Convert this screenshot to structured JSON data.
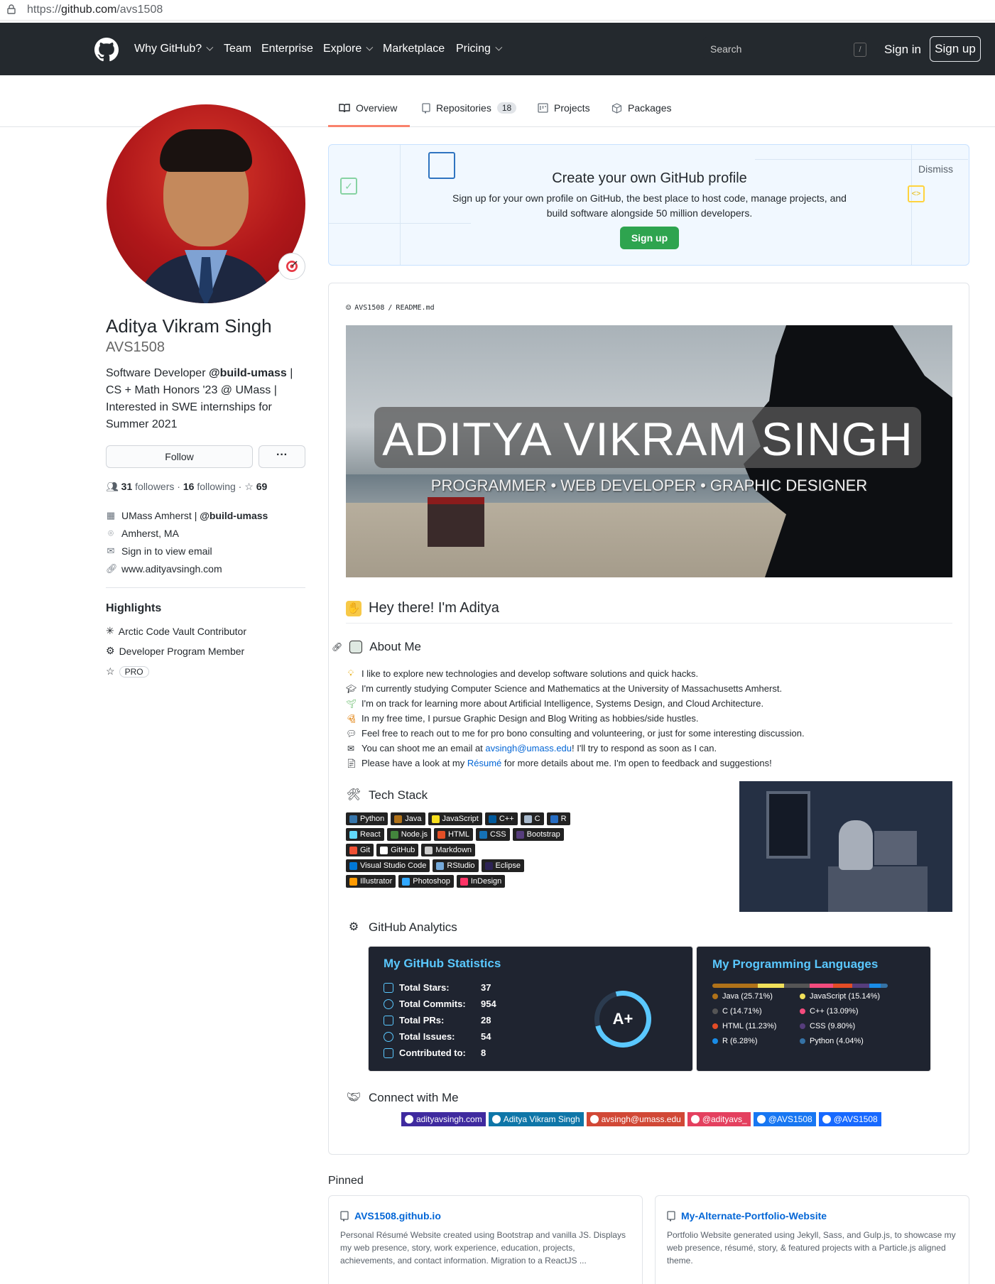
{
  "browser": {
    "url_prefix": "https://",
    "url_host": "github.com",
    "url_path": "/avs1508"
  },
  "header": {
    "nav": [
      {
        "label": "Why GitHub?",
        "caret": true
      },
      {
        "label": "Team",
        "caret": false
      },
      {
        "label": "Enterprise",
        "caret": false
      },
      {
        "label": "Explore",
        "caret": true
      },
      {
        "label": "Marketplace",
        "caret": false
      },
      {
        "label": "Pricing",
        "caret": true
      }
    ],
    "search_placeholder": "Search",
    "search_shortcut": "/",
    "sign_in": "Sign in",
    "sign_up": "Sign up"
  },
  "tabs": [
    {
      "label": "Overview",
      "icon": "book-icon",
      "active": true
    },
    {
      "label": "Repositories",
      "icon": "repo-icon",
      "count": "18"
    },
    {
      "label": "Projects",
      "icon": "project-icon"
    },
    {
      "label": "Packages",
      "icon": "package-icon"
    }
  ],
  "profile": {
    "full_name": "Aditya Vikram Singh",
    "username": "AVS1508",
    "bio_pre": "Software Developer ",
    "bio_org": "@build-umass",
    "bio_post": " | CS + Math Honors '23 @ UMass | Interested in SWE internships for Summer 2021",
    "follow_label": "Follow",
    "more_label": "···",
    "followers": "31",
    "followers_label": "followers",
    "following": "16",
    "following_label": "following",
    "stars": "69",
    "org": "UMass Amherst | ",
    "org_handle": "@build-umass",
    "location": "Amherst, MA",
    "email": "Sign in to view email",
    "website": "www.adityavsingh.com"
  },
  "highlights": {
    "title": "Highlights",
    "items": [
      "Arctic Code Vault Contributor",
      "Developer Program Member"
    ],
    "pro": "PRO"
  },
  "banner": {
    "title": "Create your own GitHub profile",
    "subtitle": "Sign up for your own profile on GitHub, the best place to host code, manage projects, and build software alongside 50 million developers.",
    "button": "Sign up",
    "dismiss": "Dismiss"
  },
  "readme": {
    "path_user": "AVS1508",
    "path_sep": "/",
    "path_file": "README.md",
    "hero_name": "ADITYA VIKRAM SINGH",
    "hero_sub": "PROGRAMMER • WEB DEVELOPER • GRAPHIC DESIGNER",
    "greeting": "Hey there! I'm Aditya",
    "about_title": "About Me",
    "about_lines": [
      {
        "pre": "I like to explore new technologies and develop software solutions and quick hacks.",
        "link": "",
        "post": ""
      },
      {
        "pre": "I'm currently studying Computer Science and Mathematics at the University of Massachusetts Amherst.",
        "link": "",
        "post": ""
      },
      {
        "pre": "I'm on track for learning more about Artificial Intelligence, Systems Design, and Cloud Architecture.",
        "link": "",
        "post": ""
      },
      {
        "pre": "In my free time, I pursue Graphic Design and Blog Writing as hobbies/side hustles.",
        "link": "",
        "post": ""
      },
      {
        "pre": "Feel free to reach out to me for pro bono consulting and volunteering, or just for some interesting discussion.",
        "link": "",
        "post": ""
      },
      {
        "pre": "You can shoot me an email at ",
        "link": "avsingh@umass.edu",
        "post": "! I'll try to respond as soon as I can."
      },
      {
        "pre": "Please have a look at my ",
        "link": "Résumé",
        "post": " for more details about me. I'm open to feedback and suggestions!"
      }
    ],
    "tech_title": "Tech Stack",
    "tech_rows": [
      [
        {
          "label": "Python",
          "color": "#3776ab"
        },
        {
          "label": "Java",
          "color": "#b07219"
        },
        {
          "label": "JavaScript",
          "color": "#f7df1e"
        },
        {
          "label": "C++",
          "color": "#00599c"
        },
        {
          "label": "C",
          "color": "#a8b9cc"
        },
        {
          "label": "R",
          "color": "#276dc3"
        }
      ],
      [
        {
          "label": "React",
          "color": "#61dafb"
        },
        {
          "label": "Node.js",
          "color": "#43853d"
        },
        {
          "label": "HTML",
          "color": "#e34f26"
        },
        {
          "label": "CSS",
          "color": "#1572b6"
        },
        {
          "label": "Bootstrap",
          "color": "#563d7c"
        }
      ],
      [
        {
          "label": "Git",
          "color": "#f05033"
        },
        {
          "label": "GitHub",
          "color": "#ffffff"
        },
        {
          "label": "Markdown",
          "color": "#cccccc"
        }
      ],
      [
        {
          "label": "Visual Studio Code",
          "color": "#0078d7"
        },
        {
          "label": "RStudio",
          "color": "#75aadb"
        },
        {
          "label": "Eclipse",
          "color": "#2c2255"
        }
      ],
      [
        {
          "label": "Illustrator",
          "color": "#ff9a00"
        },
        {
          "label": "Photoshop",
          "color": "#31a8ff"
        },
        {
          "label": "InDesign",
          "color": "#ff3366"
        }
      ]
    ],
    "analytics_title": "GitHub Analytics",
    "stats": {
      "title": "My GitHub Statistics",
      "rows": [
        {
          "label": "Total Stars:",
          "value": "37"
        },
        {
          "label": "Total Commits:",
          "value": "954"
        },
        {
          "label": "Total PRs:",
          "value": "28"
        },
        {
          "label": "Total Issues:",
          "value": "54"
        },
        {
          "label": "Contributed to:",
          "value": "8"
        }
      ],
      "grade": "A+"
    },
    "langs": {
      "title": "My Programming Languages",
      "items": [
        {
          "label": "Java (25.71%)",
          "pct": 25.71,
          "color": "#b07219"
        },
        {
          "label": "JavaScript (15.14%)",
          "pct": 15.14,
          "color": "#f1e05a"
        },
        {
          "label": "C (14.71%)",
          "pct": 14.71,
          "color": "#555555"
        },
        {
          "label": "C++ (13.09%)",
          "pct": 13.09,
          "color": "#f34b7d"
        },
        {
          "label": "HTML (11.23%)",
          "pct": 11.23,
          "color": "#e34c26"
        },
        {
          "label": "CSS (9.80%)",
          "pct": 9.8,
          "color": "#563d7c"
        },
        {
          "label": "R (6.28%)",
          "pct": 6.28,
          "color": "#198ce7"
        },
        {
          "label": "Python (4.04%)",
          "pct": 4.04,
          "color": "#3572a5"
        }
      ]
    },
    "connect_title": "Connect with Me",
    "social": [
      {
        "label": "adityavsingh.com",
        "color": "#3f2a9f"
      },
      {
        "label": "Aditya Vikram Singh",
        "color": "#0e76a8"
      },
      {
        "label": "avsingh@umass.edu",
        "color": "#d14836"
      },
      {
        "label": "@adityavs_",
        "color": "#e4405f"
      },
      {
        "label": "@AVS1508",
        "color": "#1877f2"
      },
      {
        "label": "@AVS1508",
        "color": "#1769ff"
      }
    ]
  },
  "pinned": {
    "title": "Pinned",
    "repos": [
      {
        "name": "AVS1508.github.io",
        "desc": "Personal Résumé Website created using Bootstrap and vanilla JS. Displays my web presence, story, work experience, education, projects, achievements, and contact information. Migration to a ReactJS ..."
      },
      {
        "name": "My-Alternate-Portfolio-Website",
        "desc": "Portfolio Website generated using Jekyll, Sass, and Gulp.js, to showcase my web presence, résumé, story, & featured projects with a Particle.js aligned theme."
      }
    ]
  }
}
